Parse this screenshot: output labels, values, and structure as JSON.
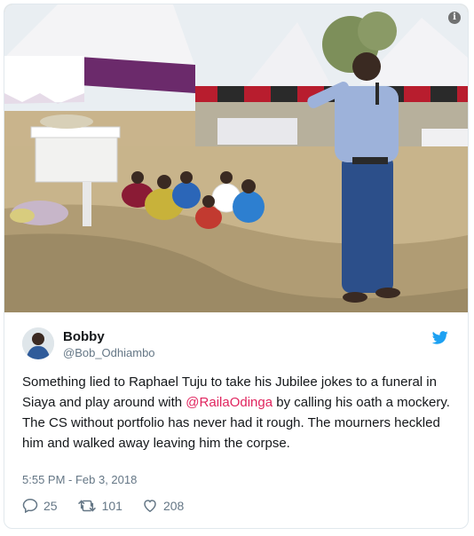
{
  "tweet": {
    "display_name": "Bobby",
    "handle": "@Bob_Odhiambo",
    "text_before": "Something lied to Raphael Tuju to take his Jubilee jokes to a funeral in Siaya and play around with ",
    "mention": "@RailaOdinga",
    "text_after": " by calling his oath a mockery. The CS without portfolio has never had it rough. The mourners heckled him and walked away leaving him the corpse.",
    "timestamp": "5:55 PM - Feb 3, 2018",
    "replies": "25",
    "retweets": "101",
    "likes": "208"
  },
  "media": {
    "info_icon": "i",
    "description_icon": "info-icon"
  },
  "colors": {
    "mention": "#e0245e",
    "bird": "#1da1f2",
    "meta": "#657786",
    "text": "#14171a"
  }
}
